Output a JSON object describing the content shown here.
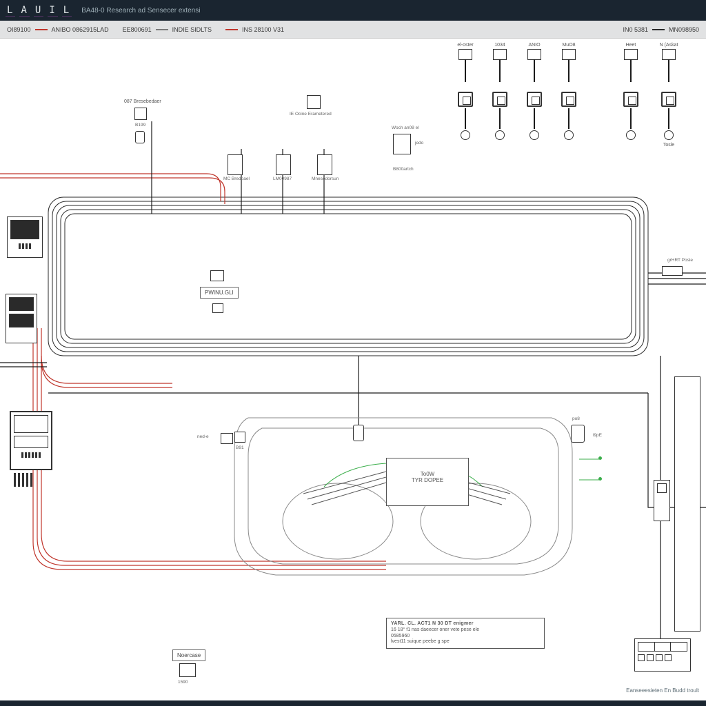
{
  "brand_letters": [
    "L",
    "A",
    "U",
    "I",
    "L"
  ],
  "title": "BA48-0 Research ad Sensecer extensi",
  "legend": {
    "item1_code": "OI89100",
    "item1_text": "ANIBO 0862915LAD",
    "item2_code": "EE800691",
    "item2_text": "INDIE SIDLTS",
    "item3_text": "INS 28100 V31",
    "right1_code": "IN0 5381",
    "right1_text": "MN098950"
  },
  "top_components": {
    "label1": "087 Bresebedaer",
    "sub1": "B199",
    "port_a": "MC Bredbael",
    "port_b": "LM00987",
    "port_c": "Mnesedorsun",
    "center_tag": "IE Ocine Erametered",
    "center_sub1": "Woch an08 el",
    "center_sub2": "jedo",
    "center_sub3": "B800artch"
  },
  "conn_headers": [
    "el-oster",
    "1034",
    "ANIO",
    "MuO8"
  ],
  "conn_headers_r": [
    "Heet",
    "N (Askat"
  ],
  "conn_caption_r": "Tosle",
  "panel": {
    "button": "PWINU.GLI"
  },
  "right_labels": {
    "l1": "grHRT Posle",
    "l2": "po8",
    "l3": "l9pE"
  },
  "ecu": {
    "line1": "To0W",
    "line2": "TYR DOPEE"
  },
  "left_small": "ned-e",
  "left_small2": "B91",
  "docblock": {
    "h": "YARL. CL. ACT1 N 30 DT enigmer",
    "l1": "16  18° f1   nas daeecer oner    vete pese ele",
    "l2": "0585960",
    "l3": "lvest11   suique peebe g spe"
  },
  "bottom_tag": "Noercase",
  "bottom_sub": "1590",
  "footer_caption": "Eanseeesieten En Budd troult"
}
